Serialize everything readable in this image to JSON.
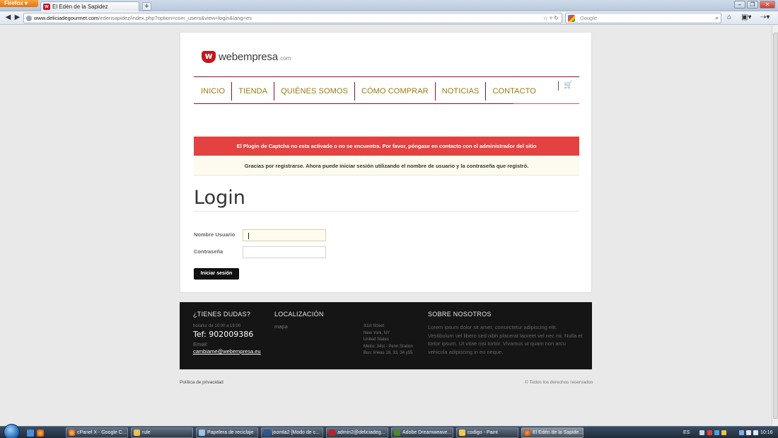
{
  "browser": {
    "app_button": "Firefox",
    "tab_title": "El Edén de la Sapidez",
    "new_tab_label": "+",
    "url_domain": "www.deliciadegourmet.com",
    "url_path": "/edensapidez/index.php?option=com_users&view=login&lang=es",
    "search_placeholder": "Google"
  },
  "site": {
    "logo_text": "webempresa",
    "logo_suffix": ".com",
    "menu": [
      "INICIO",
      "TIENDA",
      "QUIÉNES SOMOS",
      "CÓMO COMPRAR",
      "NOTICIAS",
      "CONTACTO"
    ]
  },
  "alerts": {
    "error": "El Plugin de Captcha no esta activado o no se encuentra. Por favor, póngase en contacto con el administrador del sitio",
    "info": "Gracias por registrarse. Ahora puede iniciar sesión utilizando el nombre de usuario y la contraseña que registró."
  },
  "login": {
    "title": "Login",
    "username_label": "Nombre Usuario",
    "username_value": "",
    "password_label": "Contraseña",
    "password_value": "",
    "submit_label": "Iniciar sesión"
  },
  "footer": {
    "col1": {
      "heading": "¿TIENES DUDAS?",
      "hours": "horario: de 10:00 a 19:00",
      "phone": "Tef: 902009386",
      "email_label": "Email:",
      "email": "cambiame@webempresa.eu"
    },
    "col2": {
      "heading": "LOCALIZACIÓN",
      "link": "mapa",
      "address": [
        "31st Street",
        "New York, NY",
        "United States",
        "Metro: 34st - Penn Station",
        "Bus: líneas 16, 33, 34 y55"
      ]
    },
    "col3": {
      "heading": "SOBRE NOSOTROS",
      "text": "Lorem ipsum dolor sit amet, consectetur adipiscing elit. Vestibulum vel libero sed nibh placerat laoreet vel nec mi. Nulla et tortor ipsum. Ut vitae nisi tortor. Vivamus ut quam non arcu vehicula adipiscing in eu neque."
    }
  },
  "bottom": {
    "privacy": "Política de privacidad",
    "copyright": "© Todos los derechos reservados"
  },
  "taskbar": {
    "items": [
      "cPanel X - Google C...",
      "rule",
      "Papelera de reciclaje",
      "joomla2 [Modo de c...",
      "admin2@deliciadeg...",
      "Adobe Dreamweave...",
      "codigo - Paint",
      "El Edén de la Sapide..."
    ],
    "language": "ES",
    "clock": "10:16"
  },
  "colors": {
    "brand_red": "#c4161c",
    "menu_text": "#9a7a10",
    "menu_rule": "#8a1327",
    "error_bg": "#e44141",
    "info_bg": "#fdfbef",
    "footer_bg": "#151515"
  }
}
